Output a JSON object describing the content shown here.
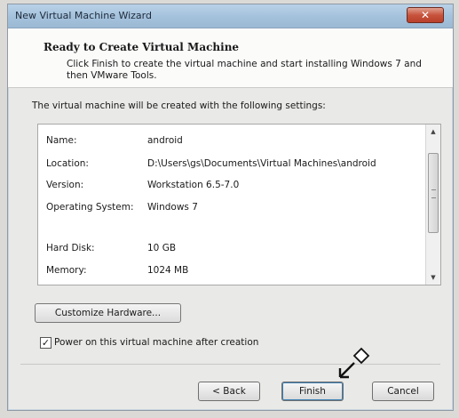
{
  "window": {
    "title": "New Virtual Machine Wizard",
    "close_label": "✕"
  },
  "header": {
    "title": "Ready to Create Virtual Machine",
    "description": "Click Finish to create the virtual machine and start installing Windows 7 and then VMware Tools."
  },
  "intro": "The virtual machine will be created with the following settings:",
  "settings": [
    {
      "label": "Name:",
      "value": "android"
    },
    {
      "label": "Location:",
      "value": "D:\\Users\\gs\\Documents\\Virtual Machines\\android"
    },
    {
      "label": "Version:",
      "value": "Workstation 6.5-7.0"
    },
    {
      "label": "Operating System:",
      "value": "Windows 7"
    },
    {
      "label": "Hard Disk:",
      "value": "10 GB"
    },
    {
      "label": "Memory:",
      "value": "1024 MB"
    }
  ],
  "customize_button": "Customize Hardware...",
  "power_on": {
    "label": "Power on this virtual machine after creation",
    "checked": true,
    "check_glyph": "✓"
  },
  "buttons": {
    "back": "< Back",
    "finish": "Finish",
    "cancel": "Cancel"
  },
  "scrollbar": {
    "up_glyph": "▲",
    "down_glyph": "▼"
  }
}
